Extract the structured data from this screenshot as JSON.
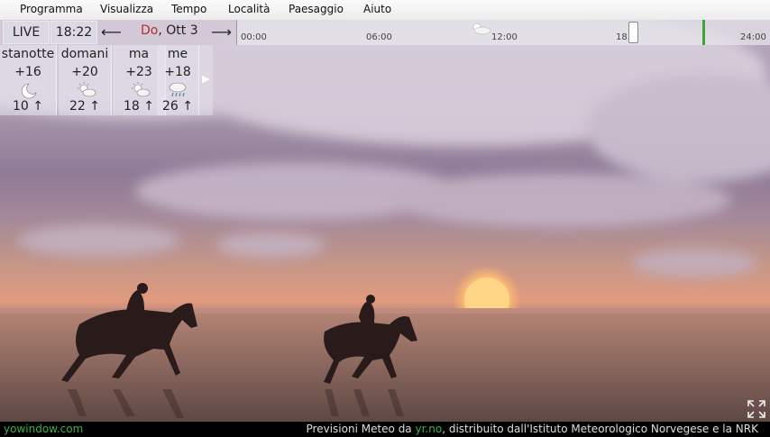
{
  "menu": [
    "Programma",
    "Visualizza",
    "Tempo",
    "Località",
    "Paesaggio",
    "Aiuto"
  ],
  "timeline": {
    "live_label": "LIVE",
    "time": "18:22",
    "date_day": "Do",
    "date_rest": ", Ott 3",
    "hours": [
      "00:00",
      "06:00",
      "12:00",
      "18:",
      "24:00"
    ]
  },
  "forecast": [
    {
      "name": "stanotte",
      "temp": "+16",
      "wind": "10",
      "icon": "moon-icon"
    },
    {
      "name": "domani",
      "temp": "+20",
      "wind": "22",
      "icon": "partly-sunny-icon"
    },
    {
      "name": "ma",
      "temp": "+23",
      "wind": "18",
      "icon": "partly-sunny-icon"
    },
    {
      "name": "me",
      "temp": "+18",
      "wind": "26",
      "icon": "rain-icon"
    }
  ],
  "footer": {
    "brand": "yowindow.com",
    "prefix": "Previsioni Meteo da",
    "link": "yr.no",
    "suffix": ", distribuito dall'Istituto Meteorologico Norvegese e la NRK"
  },
  "colors": {
    "brand_green": "#3cb04a",
    "date_red": "#b03030",
    "now_marker": "#3aa53a"
  }
}
